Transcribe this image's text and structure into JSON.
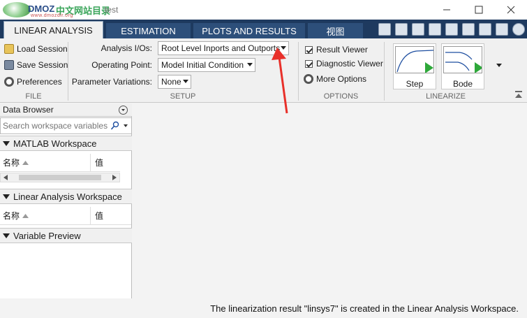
{
  "window": {
    "logo_text": "DMOZ",
    "logo_cn": "中文网站目录",
    "logo_url": "www.dmozdir.org",
    "title": "test"
  },
  "tabs": [
    {
      "label": "LINEAR ANALYSIS",
      "active": true
    },
    {
      "label": "ESTIMATION",
      "active": false
    },
    {
      "label": "PLOTS AND RESULTS",
      "active": false
    },
    {
      "label": "视图",
      "active": false
    }
  ],
  "file_section": {
    "label": "FILE",
    "load_session": "Load Session",
    "save_session": "Save Session",
    "preferences": "Preferences"
  },
  "setup_section": {
    "label": "SETUP",
    "analysis_ios_label": "Analysis I/Os:",
    "analysis_ios_value": "Root Level Inports and Outports",
    "operating_point_label": "Operating Point:",
    "operating_point_value": "Model Initial Condition",
    "param_variations_label": "Parameter Variations:",
    "param_variations_value": "None"
  },
  "options_section": {
    "label": "OPTIONS",
    "result_viewer": "Result Viewer",
    "result_viewer_checked": true,
    "diagnostic_viewer": "Diagnostic Viewer",
    "diagnostic_viewer_checked": true,
    "more_options": "More Options"
  },
  "linearize_section": {
    "label": "LINEARIZE",
    "step": "Step",
    "bode": "Bode"
  },
  "data_browser": {
    "title": "Data Browser",
    "search_placeholder": "Search workspace variables",
    "matlab_workspace": "MATLAB Workspace",
    "col_name": "名称",
    "col_value": "值",
    "linear_workspace": "Linear Analysis Workspace",
    "variable_preview": "Variable Preview"
  },
  "status": {
    "message": "The linearization result \"linsys7\" is created in the Linear Analysis Workspace."
  },
  "colors": {
    "tab_strip": "#1e3a5f",
    "tab_inactive": "#2d4f7a",
    "annotation_arrow": "#e8302a"
  }
}
